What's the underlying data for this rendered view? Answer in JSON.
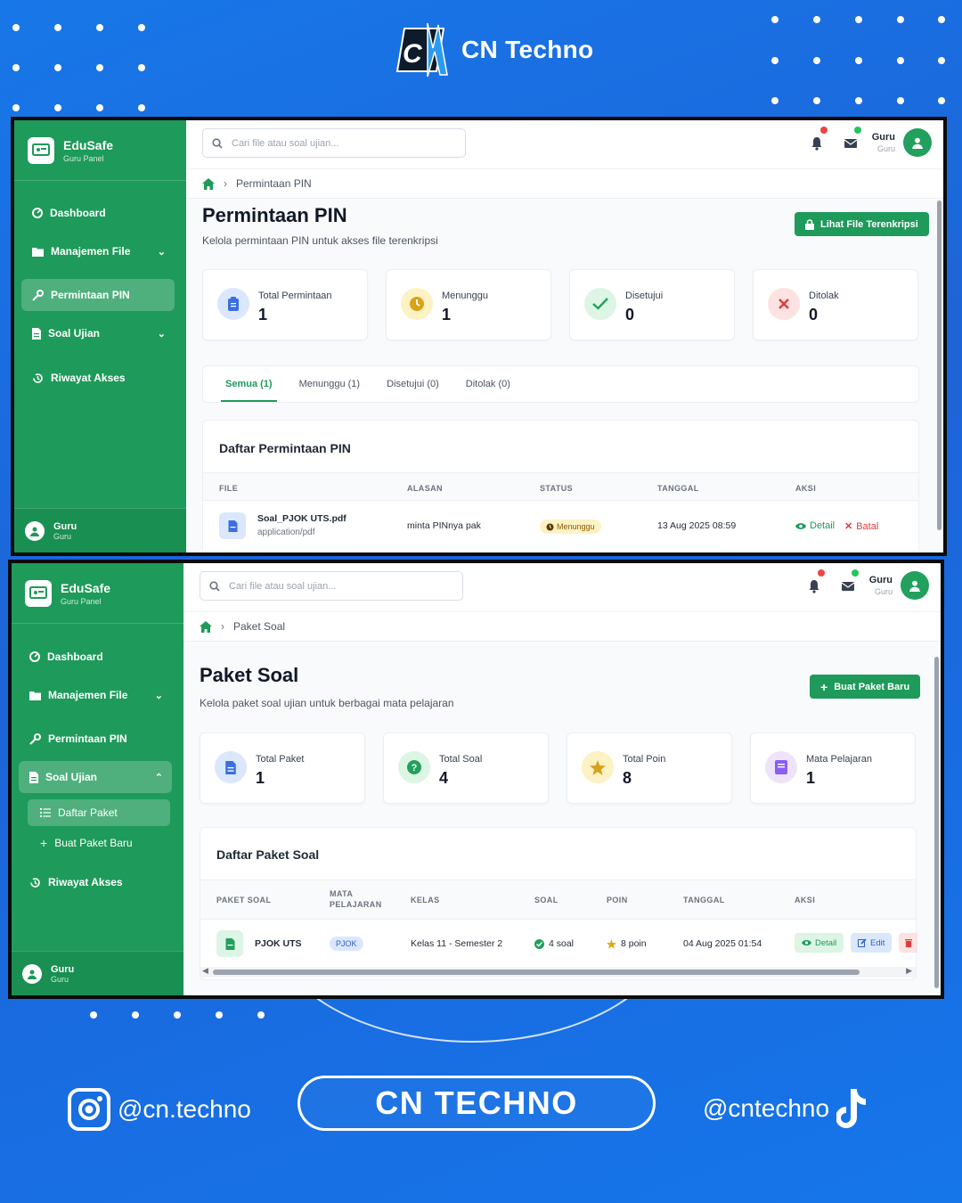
{
  "brand": {
    "name": "CN Techno",
    "logo_text": "CN"
  },
  "app": {
    "title": "EduSafe",
    "subtitle": "Guru Panel",
    "search_placeholder": "Cari file atau soal ujian...",
    "user_name": "Guru",
    "user_role": "Guru",
    "sidebar": {
      "dashboard": "Dashboard",
      "file_mgmt": "Manajemen File",
      "pin_request": "Permintaan PIN",
      "exam": "Soal Ujian",
      "access_log": "Riwayat Akses",
      "package_list": "Daftar Paket",
      "new_package": "Buat Paket Baru"
    }
  },
  "screen1": {
    "breadcrumb": "Permintaan PIN",
    "title": "Permintaan PIN",
    "subtitle": "Kelola permintaan PIN untuk akses file terenkripsi",
    "action_button": "Lihat File Terenkripsi",
    "stats": [
      {
        "label": "Total Permintaan",
        "value": "1"
      },
      {
        "label": "Menunggu",
        "value": "1"
      },
      {
        "label": "Disetujui",
        "value": "0"
      },
      {
        "label": "Ditolak",
        "value": "0"
      }
    ],
    "tabs": [
      "Semua (1)",
      "Menunggu (1)",
      "Disetujui (0)",
      "Ditolak (0)"
    ],
    "list_title": "Daftar Permintaan PIN",
    "columns": [
      "FILE",
      "ALASAN",
      "STATUS",
      "TANGGAL",
      "AKSI"
    ],
    "row": {
      "file_name": "Soal_PJOK UTS.pdf",
      "file_type": "application/pdf",
      "reason": "minta PINnya pak",
      "status": "Menunggu",
      "date": "13 Aug 2025 08:59",
      "detail": "Detail",
      "cancel": "Batal"
    }
  },
  "screen2": {
    "breadcrumb": "Paket Soal",
    "title": "Paket Soal",
    "subtitle": "Kelola paket soal ujian untuk berbagai mata pelajaran",
    "action_button": "Buat Paket Baru",
    "stats": [
      {
        "label": "Total Paket",
        "value": "1"
      },
      {
        "label": "Total Soal",
        "value": "4"
      },
      {
        "label": "Total Poin",
        "value": "8"
      },
      {
        "label": "Mata Pelajaran",
        "value": "1"
      }
    ],
    "list_title": "Daftar Paket Soal",
    "columns": [
      "PAKET SOAL",
      "MATA",
      "PELAJARAN",
      "KELAS",
      "SOAL",
      "POIN",
      "TANGGAL",
      "AKSI"
    ],
    "row": {
      "package": "PJOK UTS",
      "subject": "PJOK",
      "class": "Kelas 11 - Semester 2",
      "questions": "4 soal",
      "points": "8 poin",
      "date": "04 Aug 2025 01:54",
      "detail": "Detail",
      "edit": "Edit"
    }
  },
  "footer": {
    "instagram": "@cn.techno",
    "cta": "CN TECHNO",
    "tiktok": "@cntechno"
  }
}
